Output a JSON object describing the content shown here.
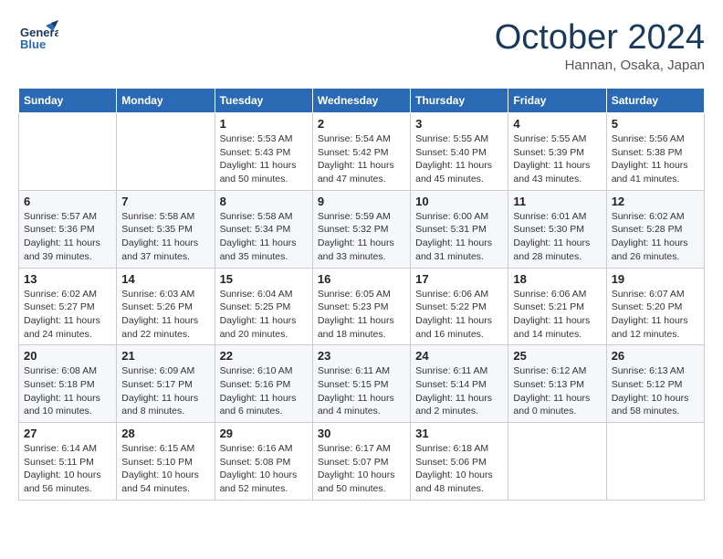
{
  "header": {
    "logo_general": "General",
    "logo_blue": "Blue",
    "month": "October 2024",
    "location": "Hannan, Osaka, Japan"
  },
  "days_of_week": [
    "Sunday",
    "Monday",
    "Tuesday",
    "Wednesday",
    "Thursday",
    "Friday",
    "Saturday"
  ],
  "weeks": [
    [
      {
        "day": "",
        "content": ""
      },
      {
        "day": "",
        "content": ""
      },
      {
        "day": "1",
        "content": "Sunrise: 5:53 AM\nSunset: 5:43 PM\nDaylight: 11 hours and 50 minutes."
      },
      {
        "day": "2",
        "content": "Sunrise: 5:54 AM\nSunset: 5:42 PM\nDaylight: 11 hours and 47 minutes."
      },
      {
        "day": "3",
        "content": "Sunrise: 5:55 AM\nSunset: 5:40 PM\nDaylight: 11 hours and 45 minutes."
      },
      {
        "day": "4",
        "content": "Sunrise: 5:55 AM\nSunset: 5:39 PM\nDaylight: 11 hours and 43 minutes."
      },
      {
        "day": "5",
        "content": "Sunrise: 5:56 AM\nSunset: 5:38 PM\nDaylight: 11 hours and 41 minutes."
      }
    ],
    [
      {
        "day": "6",
        "content": "Sunrise: 5:57 AM\nSunset: 5:36 PM\nDaylight: 11 hours and 39 minutes."
      },
      {
        "day": "7",
        "content": "Sunrise: 5:58 AM\nSunset: 5:35 PM\nDaylight: 11 hours and 37 minutes."
      },
      {
        "day": "8",
        "content": "Sunrise: 5:58 AM\nSunset: 5:34 PM\nDaylight: 11 hours and 35 minutes."
      },
      {
        "day": "9",
        "content": "Sunrise: 5:59 AM\nSunset: 5:32 PM\nDaylight: 11 hours and 33 minutes."
      },
      {
        "day": "10",
        "content": "Sunrise: 6:00 AM\nSunset: 5:31 PM\nDaylight: 11 hours and 31 minutes."
      },
      {
        "day": "11",
        "content": "Sunrise: 6:01 AM\nSunset: 5:30 PM\nDaylight: 11 hours and 28 minutes."
      },
      {
        "day": "12",
        "content": "Sunrise: 6:02 AM\nSunset: 5:28 PM\nDaylight: 11 hours and 26 minutes."
      }
    ],
    [
      {
        "day": "13",
        "content": "Sunrise: 6:02 AM\nSunset: 5:27 PM\nDaylight: 11 hours and 24 minutes."
      },
      {
        "day": "14",
        "content": "Sunrise: 6:03 AM\nSunset: 5:26 PM\nDaylight: 11 hours and 22 minutes."
      },
      {
        "day": "15",
        "content": "Sunrise: 6:04 AM\nSunset: 5:25 PM\nDaylight: 11 hours and 20 minutes."
      },
      {
        "day": "16",
        "content": "Sunrise: 6:05 AM\nSunset: 5:23 PM\nDaylight: 11 hours and 18 minutes."
      },
      {
        "day": "17",
        "content": "Sunrise: 6:06 AM\nSunset: 5:22 PM\nDaylight: 11 hours and 16 minutes."
      },
      {
        "day": "18",
        "content": "Sunrise: 6:06 AM\nSunset: 5:21 PM\nDaylight: 11 hours and 14 minutes."
      },
      {
        "day": "19",
        "content": "Sunrise: 6:07 AM\nSunset: 5:20 PM\nDaylight: 11 hours and 12 minutes."
      }
    ],
    [
      {
        "day": "20",
        "content": "Sunrise: 6:08 AM\nSunset: 5:18 PM\nDaylight: 11 hours and 10 minutes."
      },
      {
        "day": "21",
        "content": "Sunrise: 6:09 AM\nSunset: 5:17 PM\nDaylight: 11 hours and 8 minutes."
      },
      {
        "day": "22",
        "content": "Sunrise: 6:10 AM\nSunset: 5:16 PM\nDaylight: 11 hours and 6 minutes."
      },
      {
        "day": "23",
        "content": "Sunrise: 6:11 AM\nSunset: 5:15 PM\nDaylight: 11 hours and 4 minutes."
      },
      {
        "day": "24",
        "content": "Sunrise: 6:11 AM\nSunset: 5:14 PM\nDaylight: 11 hours and 2 minutes."
      },
      {
        "day": "25",
        "content": "Sunrise: 6:12 AM\nSunset: 5:13 PM\nDaylight: 11 hours and 0 minutes."
      },
      {
        "day": "26",
        "content": "Sunrise: 6:13 AM\nSunset: 5:12 PM\nDaylight: 10 hours and 58 minutes."
      }
    ],
    [
      {
        "day": "27",
        "content": "Sunrise: 6:14 AM\nSunset: 5:11 PM\nDaylight: 10 hours and 56 minutes."
      },
      {
        "day": "28",
        "content": "Sunrise: 6:15 AM\nSunset: 5:10 PM\nDaylight: 10 hours and 54 minutes."
      },
      {
        "day": "29",
        "content": "Sunrise: 6:16 AM\nSunset: 5:08 PM\nDaylight: 10 hours and 52 minutes."
      },
      {
        "day": "30",
        "content": "Sunrise: 6:17 AM\nSunset: 5:07 PM\nDaylight: 10 hours and 50 minutes."
      },
      {
        "day": "31",
        "content": "Sunrise: 6:18 AM\nSunset: 5:06 PM\nDaylight: 10 hours and 48 minutes."
      },
      {
        "day": "",
        "content": ""
      },
      {
        "day": "",
        "content": ""
      }
    ]
  ]
}
